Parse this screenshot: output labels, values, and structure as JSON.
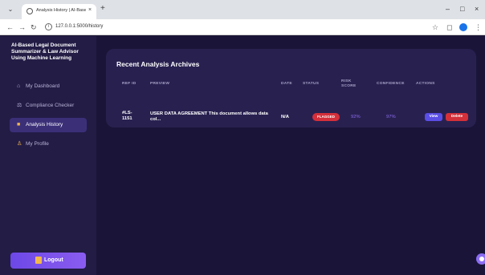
{
  "browser": {
    "tab_title": "Analysis History | AI-Based Legal D",
    "tab_close": "×",
    "new_tab": "+",
    "url": "127.0.0.1:5000/history",
    "window_controls": [
      "–",
      "□",
      "×"
    ]
  },
  "sidebar": {
    "brand": "AI-Based Legal Document Summarizer & Law Advisor Using Machine Learning",
    "items": [
      {
        "label": "My Dashboard",
        "icon": "home-icon",
        "active": false
      },
      {
        "label": "Compliance Checker",
        "icon": "scales-icon",
        "active": false
      },
      {
        "label": "Analysis History",
        "icon": "folder-icon",
        "active": true
      },
      {
        "label": "My Profile",
        "icon": "user-icon",
        "active": false
      }
    ],
    "logout_label": "Logout"
  },
  "archive": {
    "title": "Recent Analysis Archives",
    "headers": {
      "ref_id": "REF ID",
      "preview": "PREVIEW",
      "date": "DATE",
      "status": "STATUS",
      "risk_score": "RISK SCORE",
      "confidence": "CONFIDENCE",
      "actions": "ACTIONS"
    },
    "rows": [
      {
        "ref_id": "#LS-1151",
        "preview": "USER DATA AGREEMENT This document allows data col...",
        "date": "N/A",
        "status": "FLAGGED",
        "risk_score": "92%",
        "confidence": "97%",
        "view_label": "View",
        "delete_label": "Delete"
      }
    ]
  },
  "colors": {
    "accent": "#6d48e6",
    "flagged": "#d42f3a",
    "percent_text": "#8e6bf0"
  }
}
